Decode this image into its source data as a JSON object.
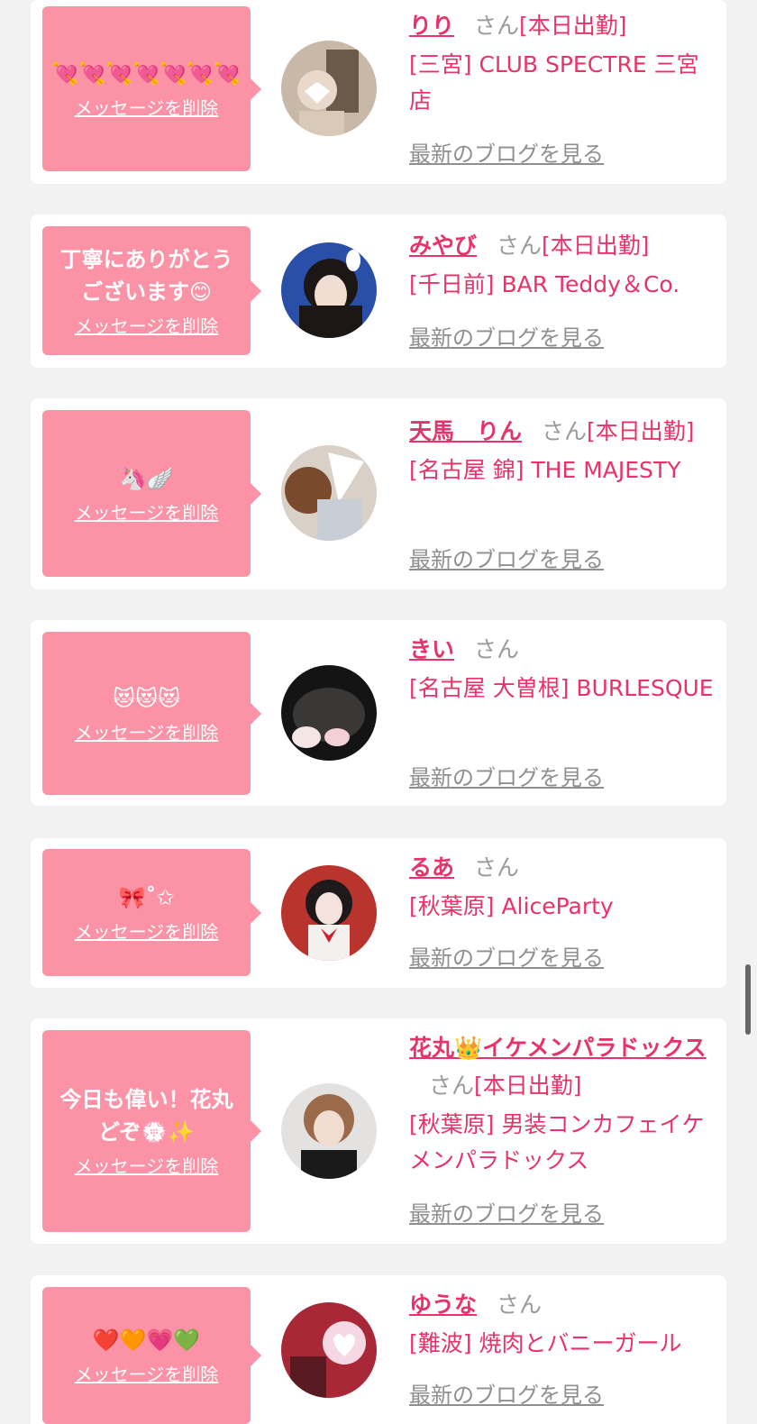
{
  "common": {
    "delete_label": "メッセージを削除",
    "blog_label": "最新のブログを見る",
    "san": "さん",
    "on_duty": "[本日出勤]"
  },
  "colors": {
    "bubble": "#fb92a5",
    "accent": "#e8326a",
    "muted": "#8f8f8f",
    "page_bg": "#f2f2f2"
  },
  "entries": [
    {
      "message": "💘💘💘💘💘💘💘",
      "name": "りり",
      "on_duty": true,
      "shop": "[三宮] CLUB SPECTRE 三宮店"
    },
    {
      "message": "丁寧にありがとうございます😊",
      "name": "みやび",
      "on_duty": true,
      "shop": "[千日前] BAR Teddy＆Co."
    },
    {
      "message": "🦄🪽",
      "name": "天馬　りん",
      "on_duty": true,
      "shop": "[名古屋 錦] THE MAJESTY"
    },
    {
      "message": "😻😻😻",
      "name": "きい",
      "on_duty": false,
      "shop": "[名古屋 大曽根] BURLESQUE"
    },
    {
      "message": "🎀˚✩",
      "name": "るあ",
      "on_duty": false,
      "shop": "[秋葉原] AliceParty"
    },
    {
      "message": "今日も偉い！花丸どぞ💮✨",
      "name": "花丸👑イケメンパラドックス",
      "on_duty": true,
      "shop": "[秋葉原] 男装コンカフェイケメンパラドックス"
    },
    {
      "message": "❤️🧡💗💚",
      "name": "ゆうな",
      "on_duty": false,
      "shop": "[難波] 焼肉とバニーガール"
    }
  ]
}
